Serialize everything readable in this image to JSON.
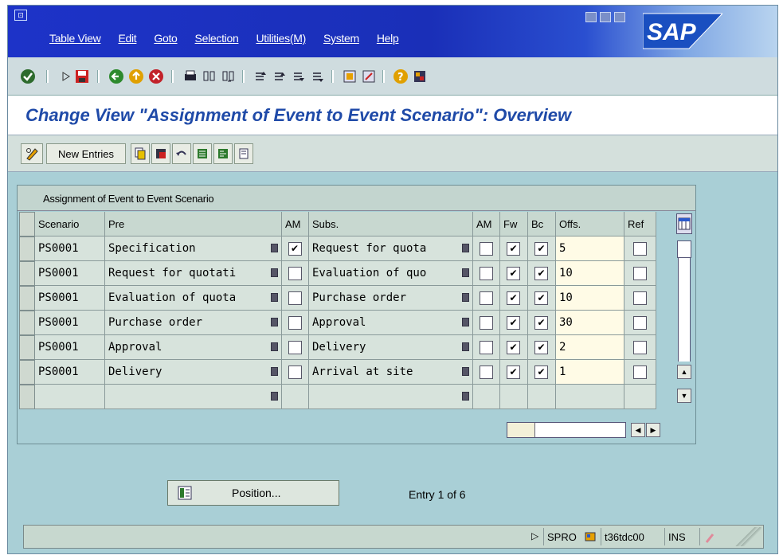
{
  "menubar": {
    "items": [
      "Table View",
      "Edit",
      "Goto",
      "Selection",
      "Utilities(M)",
      "System",
      "Help"
    ]
  },
  "brand": {
    "logo_text": "SAP"
  },
  "header": {
    "title": "Change View \"Assignment of Event to Event Scenario\": Overview"
  },
  "app_toolbar": {
    "new_entries_label": "New Entries"
  },
  "table": {
    "title": "Assignment of Event to Event Scenario",
    "columns": [
      "Scenario",
      "Pre",
      "AM",
      "Subs.",
      "AM",
      "Fw",
      "Bc",
      "Offs.",
      "Ref"
    ],
    "rows": [
      {
        "scenario": "PS0001",
        "pre": "Specification",
        "pre_am": true,
        "subs": "Request for quota",
        "subs_am": false,
        "fw": true,
        "bc": true,
        "offs": "5",
        "ref": false
      },
      {
        "scenario": "PS0001",
        "pre": "Request for quotati",
        "pre_am": false,
        "subs": "Evaluation of quo",
        "subs_am": false,
        "fw": true,
        "bc": true,
        "offs": "10",
        "ref": false
      },
      {
        "scenario": "PS0001",
        "pre": "Evaluation of quota",
        "pre_am": false,
        "subs": "Purchase order",
        "subs_am": false,
        "fw": true,
        "bc": true,
        "offs": "10",
        "ref": false
      },
      {
        "scenario": "PS0001",
        "pre": "Purchase order",
        "pre_am": false,
        "subs": "Approval",
        "subs_am": false,
        "fw": true,
        "bc": true,
        "offs": "30",
        "ref": false
      },
      {
        "scenario": "PS0001",
        "pre": "Approval",
        "pre_am": false,
        "subs": "Delivery",
        "subs_am": false,
        "fw": true,
        "bc": true,
        "offs": "2",
        "ref": false
      },
      {
        "scenario": "PS0001",
        "pre": "Delivery",
        "pre_am": false,
        "subs": "Arrival at site",
        "subs_am": false,
        "fw": true,
        "bc": true,
        "offs": "1",
        "ref": false
      }
    ]
  },
  "footer": {
    "position_label": "Position...",
    "entry_text": "Entry 1 of 6"
  },
  "status": {
    "transaction": "SPRO",
    "system": "t36tdc00",
    "mode": "INS"
  },
  "colors": {
    "title_blue": "#1f4aa8",
    "titlebar": "#1d33c8",
    "background": "#a9cfd6"
  }
}
